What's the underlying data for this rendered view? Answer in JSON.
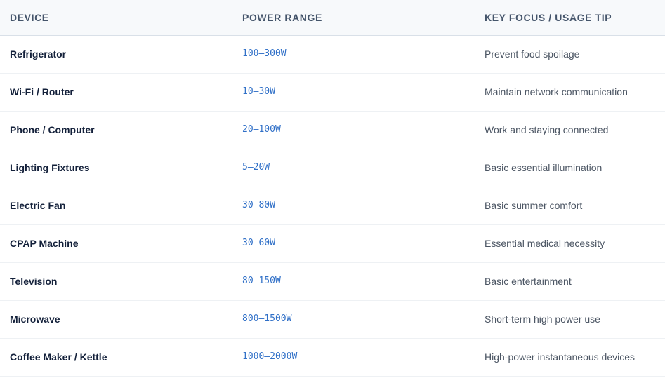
{
  "table": {
    "headers": {
      "device": "DEVICE",
      "power": "POWER RANGE",
      "tip": "KEY FOCUS / USAGE TIP"
    },
    "rows": [
      {
        "device": "Refrigerator",
        "power": "100–300W",
        "tip": "Prevent food spoilage"
      },
      {
        "device": "Wi-Fi / Router",
        "power": "10–30W",
        "tip": "Maintain network communication"
      },
      {
        "device": "Phone / Computer",
        "power": "20–100W",
        "tip": "Work and staying connected"
      },
      {
        "device": "Lighting Fixtures",
        "power": "5–20W",
        "tip": "Basic essential illumination"
      },
      {
        "device": "Electric Fan",
        "power": "30–80W",
        "tip": "Basic summer comfort"
      },
      {
        "device": "CPAP Machine",
        "power": "30–60W",
        "tip": "Essential medical necessity"
      },
      {
        "device": "Television",
        "power": "80–150W",
        "tip": "Basic entertainment"
      },
      {
        "device": "Microwave",
        "power": "800–1500W",
        "tip": "Short-term high power use"
      },
      {
        "device": "Coffee Maker / Kettle",
        "power": "1000–2000W",
        "tip": "High-power instantaneous devices"
      }
    ]
  },
  "colors": {
    "header_bg": "#f7f9fb",
    "header_text": "#44546a",
    "device_text": "#13203a",
    "power_text": "#2f6fc7",
    "tip_text": "#4b5563"
  }
}
